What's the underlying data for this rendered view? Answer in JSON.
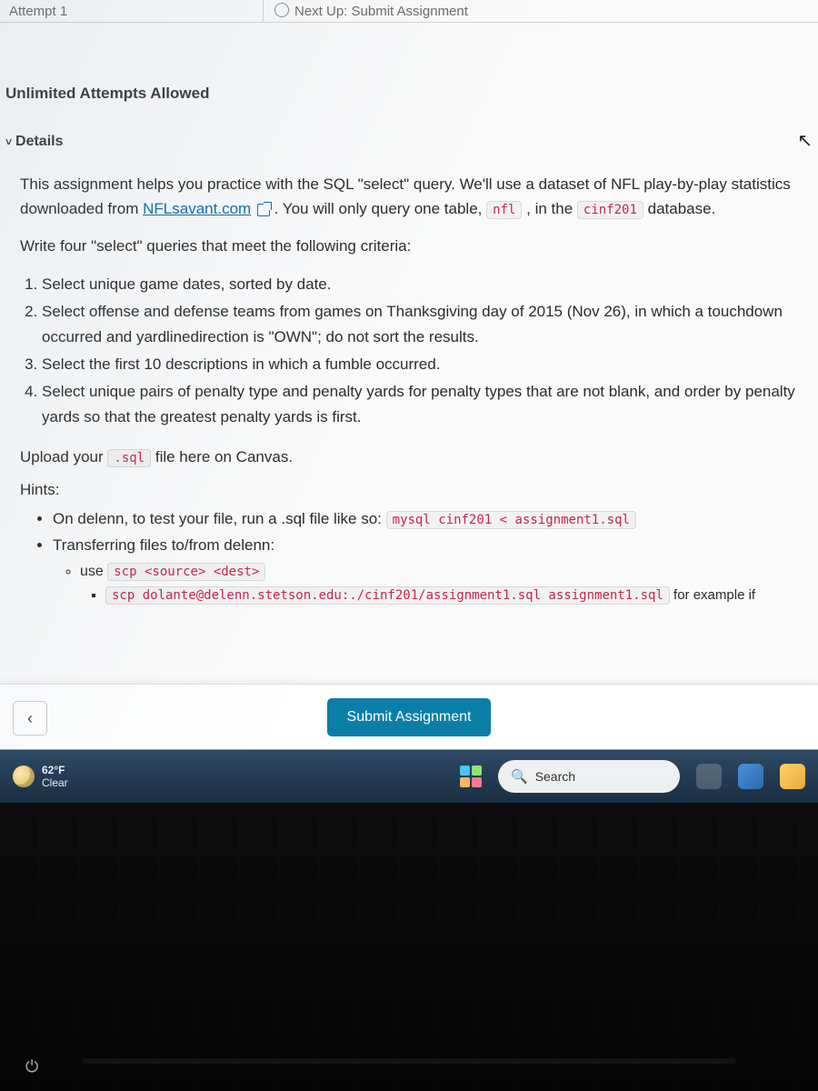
{
  "top": {
    "attempt": "Attempt 1",
    "next": "Next Up: Submit Assignment"
  },
  "attempts_allowed": "Unlimited Attempts Allowed",
  "details_label": "Details",
  "intro": {
    "p1a": "This assignment helps you practice with the SQL \"select\" query. We'll use a dataset of NFL play-by-play statistics downloaded from ",
    "link": "NFLsavant.com",
    "p1b": ". You will only query one table, ",
    "code_nfl": "nfl",
    "p1c": ", in the ",
    "code_db": "cinf201",
    "p1d": " database."
  },
  "write_line": "Write four \"select\" queries that meet the following criteria:",
  "criteria": [
    "Select unique game dates, sorted by date.",
    "Select offense and defense teams from games on Thanksgiving day of 2015 (Nov 26), in which a touchdown occurred and yardlinedirection is \"OWN\"; do not sort the results.",
    "Select the first 10 descriptions in which a fumble occurred.",
    "Select unique pairs of penalty type and penalty yards for penalty types that are not blank, and order by penalty yards so that the greatest penalty yards is first."
  ],
  "upload": {
    "a": "Upload your ",
    "code": ".sql",
    "b": " file here on Canvas."
  },
  "hints_label": "Hints:",
  "hints": {
    "h1a": "On delenn, to test your file, run a .sql file like so: ",
    "h1_code": "mysql cinf201 < assignment1.sql",
    "h2": "Transferring files to/from delenn:",
    "h2_use": "use ",
    "h2_usecode": "scp <source> <dest>",
    "h2_ex_code": "scp dolante@delenn.stetson.edu:./cinf201/assignment1.sql assignment1.sql",
    "h2_ex_tail": " for example if"
  },
  "buttons": {
    "back": "‹",
    "submit": "Submit Assignment"
  },
  "taskbar": {
    "temp": "62°F",
    "cond": "Clear",
    "search": "Search"
  }
}
